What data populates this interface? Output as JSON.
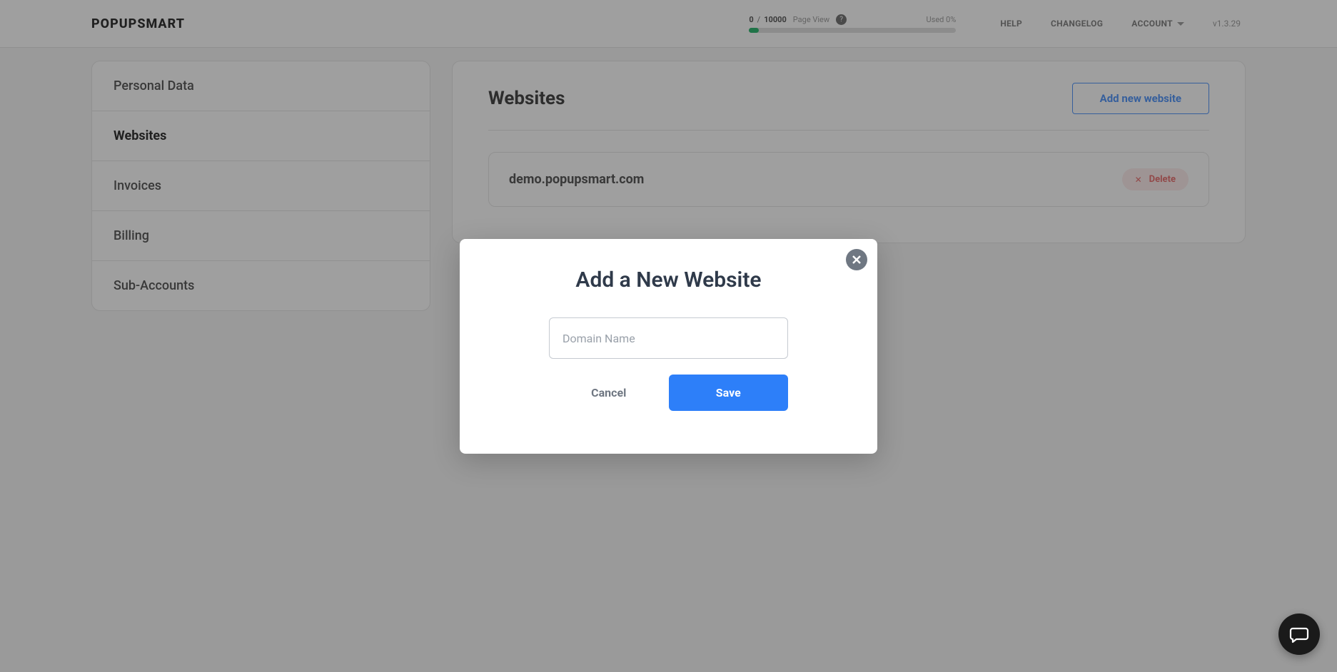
{
  "header": {
    "logo": "POPUPSMART",
    "pageview": {
      "current": "0",
      "separator": "/",
      "max": "10000",
      "label": "Page View",
      "used": "Used 0%"
    },
    "nav": {
      "help": "HELP",
      "changelog": "CHANGELOG",
      "account": "ACCOUNT"
    },
    "version": "v1.3.29"
  },
  "sidebar": {
    "items": [
      {
        "label": "Personal Data"
      },
      {
        "label": "Websites"
      },
      {
        "label": "Invoices"
      },
      {
        "label": "Billing"
      },
      {
        "label": "Sub-Accounts"
      }
    ]
  },
  "content": {
    "title": "Websites",
    "add_btn": "Add new website",
    "websites": [
      {
        "domain": "demo.popupsmart.com",
        "delete_label": "Delete"
      }
    ]
  },
  "modal": {
    "title": "Add a New Website",
    "placeholder": "Domain Name",
    "cancel": "Cancel",
    "save": "Save"
  }
}
